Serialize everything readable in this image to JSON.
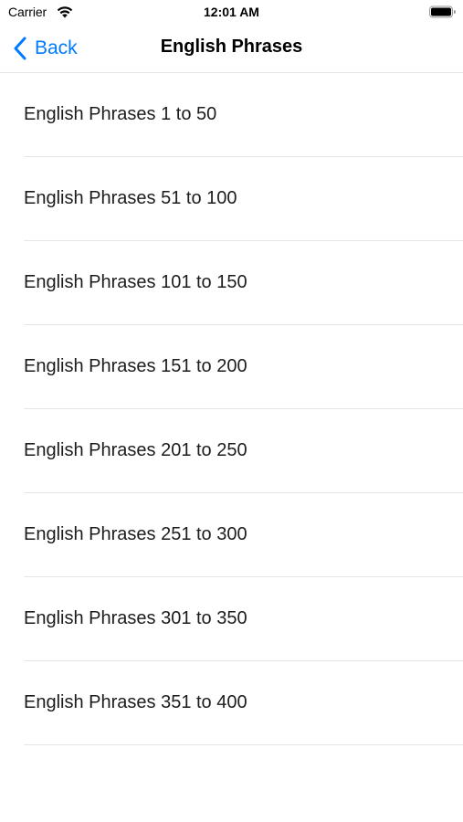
{
  "status_bar": {
    "carrier": "Carrier",
    "time": "12:01 AM",
    "wifi_icon": "wifi-icon",
    "battery_icon": "battery-icon"
  },
  "nav": {
    "back_label": "Back",
    "title": "English Phrases",
    "accent_color": "#007aff"
  },
  "list": {
    "items": [
      {
        "label": "English Phrases 1 to 50"
      },
      {
        "label": "English Phrases 51 to 100"
      },
      {
        "label": "English Phrases 101 to 150"
      },
      {
        "label": "English Phrases 151 to 200"
      },
      {
        "label": "English Phrases 201 to 250"
      },
      {
        "label": "English Phrases 251 to 300"
      },
      {
        "label": "English Phrases 301 to 350"
      },
      {
        "label": "English Phrases 351 to 400"
      }
    ]
  }
}
